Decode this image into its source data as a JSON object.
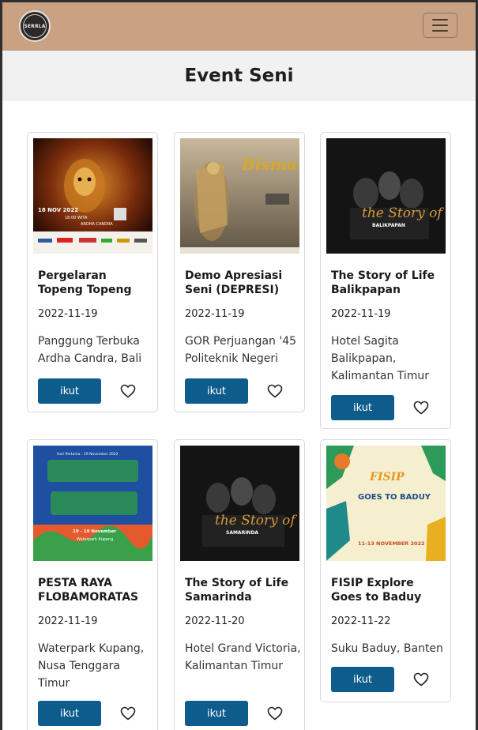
{
  "brand": {
    "logo_text": "SERRLA"
  },
  "page_title": "Event Seni",
  "events": [
    {
      "title": "Pergelaran Topeng Topeng",
      "date": "2022-11-19",
      "location": "Panggung Terbuka Ardha Candra, Bali",
      "button": "ikut"
    },
    {
      "title": "Demo Apresiasi Seni (DEPRESI)",
      "date": "2022-11-19",
      "location": "GOR Perjuangan '45 Politeknik Negeri",
      "button": "ikut"
    },
    {
      "title": "The Story of Life Balikpapan",
      "date": "2022-11-19",
      "location": "Hotel Sagita Balikpapan, Kalimantan Timur",
      "button": "ikut"
    },
    {
      "title": "PESTA RAYA FLOBAMORATAS",
      "date": "2022-11-19",
      "location": "Waterpark Kupang, Nusa Tenggara Timur",
      "button": "ikut"
    },
    {
      "title": "The Story of Life Samarinda",
      "date": "2022-11-20",
      "location": "Hotel Grand Victoria, Kalimantan Timur",
      "button": "ikut"
    },
    {
      "title": "FISIP Explore Goes to Baduy",
      "date": "2022-11-22",
      "location": "Suku Baduy, Banten",
      "button": "ikut"
    }
  ],
  "posters": {
    "p1": {
      "date": "18 NOV 2022",
      "time": "18.00 WITA",
      "place": "ARDHA CANDRA"
    },
    "p2": {
      "title": "Bisma"
    },
    "p3": {
      "script": "the Story of Life",
      "city": "BALIKPAPAN"
    },
    "p4": {
      "header": "Hari Pertama - 19 November 2022",
      "dates": "19 - 19 November",
      "venue": "Waterpark Kupang"
    },
    "p5": {
      "script": "the Story of Life",
      "city": "SAMARINDA"
    },
    "p6": {
      "title": "FISIP",
      "line1": "GOES TO BADUY",
      "dates": "11-13 NOVEMBER 2022"
    }
  },
  "colors": {
    "navbar": "#c9a283",
    "button": "#0e5c8c",
    "title_band": "#f1f1f1"
  },
  "icons": {
    "menu": "hamburger-icon",
    "favorite": "heart-outline-icon"
  }
}
